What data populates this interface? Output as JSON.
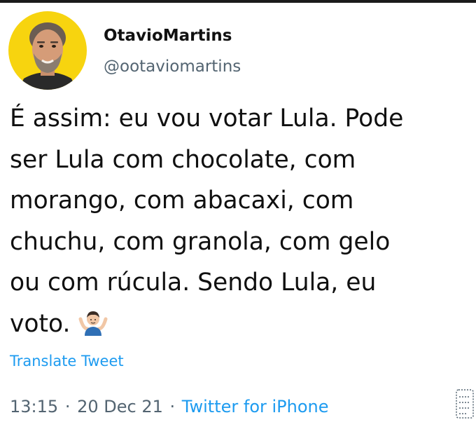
{
  "author": {
    "name": "OtavioMartins",
    "handle": "@ootaviomartins"
  },
  "tweet": {
    "lines": [
      "É assim: eu vou votar Lula. Pode",
      "ser Lula com chocolate, com",
      "morango, com abacaxi, com",
      "chuchu, com granola, com gelo",
      "ou com rúcula. Sendo Lula, eu",
      "voto."
    ],
    "emoji_icon": "person-shrugging-icon",
    "translate_label": "Translate Tweet",
    "time": "13:15",
    "date": "20 Dec 21",
    "separator": "·",
    "source": "Twitter for iPhone"
  },
  "colors": {
    "avatar_bg": "#f7d40f",
    "link": "#1d9bf0",
    "secondary_text": "#536471"
  }
}
